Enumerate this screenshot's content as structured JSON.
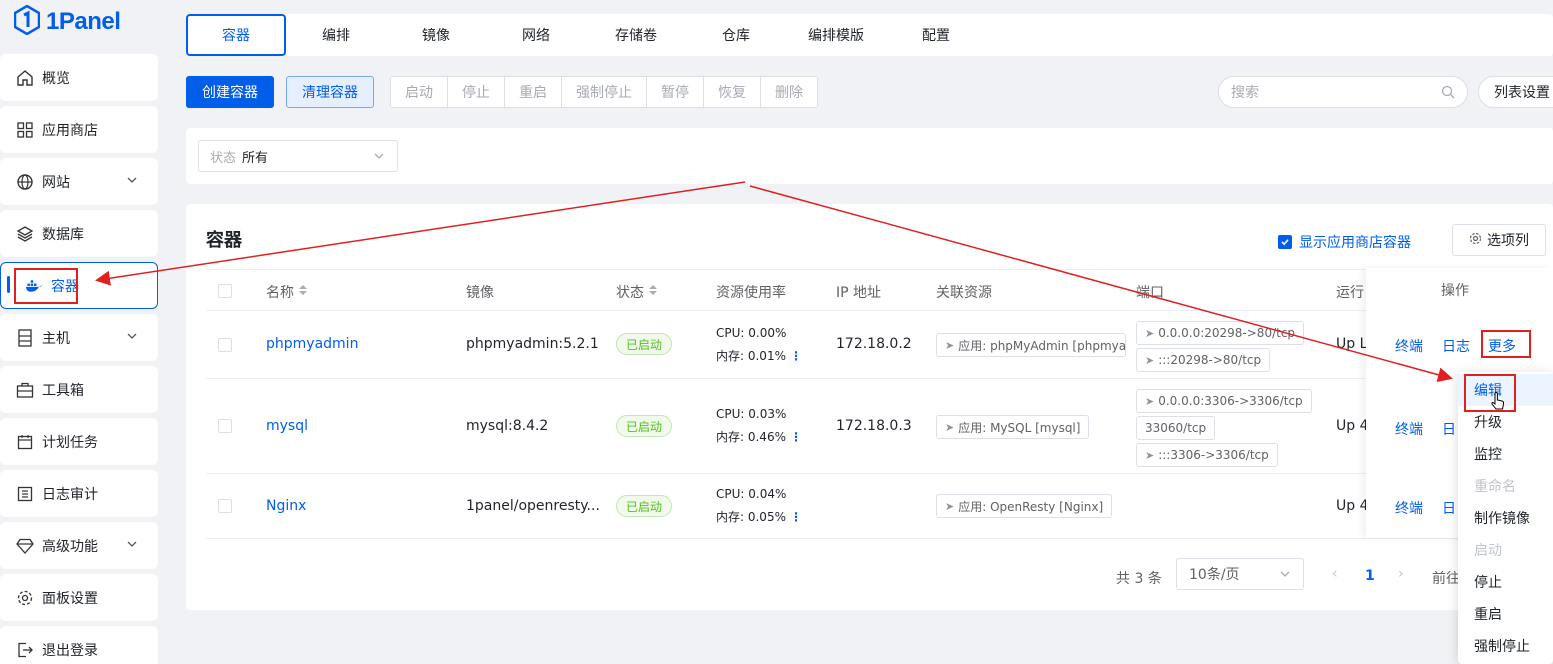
{
  "brand": {
    "name": "1Panel"
  },
  "sidebar": {
    "items": [
      {
        "label": "概览"
      },
      {
        "label": "应用商店"
      },
      {
        "label": "网站"
      },
      {
        "label": "数据库"
      },
      {
        "label": "容器"
      },
      {
        "label": "主机"
      },
      {
        "label": "工具箱"
      },
      {
        "label": "计划任务"
      },
      {
        "label": "日志审计"
      },
      {
        "label": "高级功能"
      },
      {
        "label": "面板设置"
      },
      {
        "label": "退出登录"
      }
    ]
  },
  "tabs": [
    "容器",
    "编排",
    "镜像",
    "网络",
    "存储卷",
    "仓库",
    "编排模版",
    "配置"
  ],
  "toolbar": {
    "create": "创建容器",
    "clean": "清理容器",
    "actions": [
      "启动",
      "停止",
      "重启",
      "强制停止",
      "暂停",
      "恢复",
      "删除"
    ],
    "search_placeholder": "搜索",
    "list_settings": "列表设置"
  },
  "filter": {
    "label": "状态",
    "value": "所有"
  },
  "card": {
    "title": "容器",
    "show_app": "显示应用商店容器",
    "columns_btn": "选项列"
  },
  "table": {
    "headers": [
      "名称",
      "镜像",
      "状态",
      "资源使用率",
      "IP 地址",
      "关联资源",
      "端口",
      "运行",
      "操作"
    ],
    "rows": [
      {
        "name": "phpmyadmin",
        "image": "phpmyadmin:5.2.1",
        "status": "已启动",
        "cpu": "CPU: 0.00%",
        "mem": "内存: 0.01%",
        "ip": "172.18.0.2",
        "resource": "应用: phpMyAdmin [phpmyadmin]",
        "ports": [
          "0.0.0.0:20298->80/tcp",
          ":::20298->80/tcp"
        ],
        "uptime": "Up L",
        "ops": [
          "终端",
          "日志",
          "更多"
        ]
      },
      {
        "name": "mysql",
        "image": "mysql:8.4.2",
        "status": "已启动",
        "cpu": "CPU: 0.03%",
        "mem": "内存: 0.46%",
        "ip": "172.18.0.3",
        "resource": "应用: MySQL [mysql]",
        "ports": [
          "0.0.0.0:3306->3306/tcp",
          "33060/tcp",
          ":::3306->3306/tcp"
        ],
        "uptime": "Up 4",
        "ops": [
          "终端",
          "日"
        ]
      },
      {
        "name": "Nginx",
        "image": "1panel/openresty...",
        "status": "已启动",
        "cpu": "CPU: 0.04%",
        "mem": "内存: 0.05%",
        "ip": "",
        "resource": "应用: OpenResty [Nginx]",
        "ports": [],
        "uptime": "Up 4",
        "ops": [
          "终端",
          "日"
        ]
      }
    ]
  },
  "pagination": {
    "total": "共 3 条",
    "page_size": "10条/页",
    "current": "1",
    "goto": "前往"
  },
  "dropdown": {
    "items": [
      {
        "label": "编辑",
        "disabled": false
      },
      {
        "label": "升级",
        "disabled": false
      },
      {
        "label": "监控",
        "disabled": false
      },
      {
        "label": "重命名",
        "disabled": true
      },
      {
        "label": "制作镜像",
        "disabled": false
      },
      {
        "label": "启动",
        "disabled": true
      },
      {
        "label": "停止",
        "disabled": false
      },
      {
        "label": "重启",
        "disabled": false
      },
      {
        "label": "强制停止",
        "disabled": false
      }
    ]
  },
  "colors": {
    "primary": "#005eeb",
    "success": "#52c41a",
    "annotation": "#e02020"
  }
}
